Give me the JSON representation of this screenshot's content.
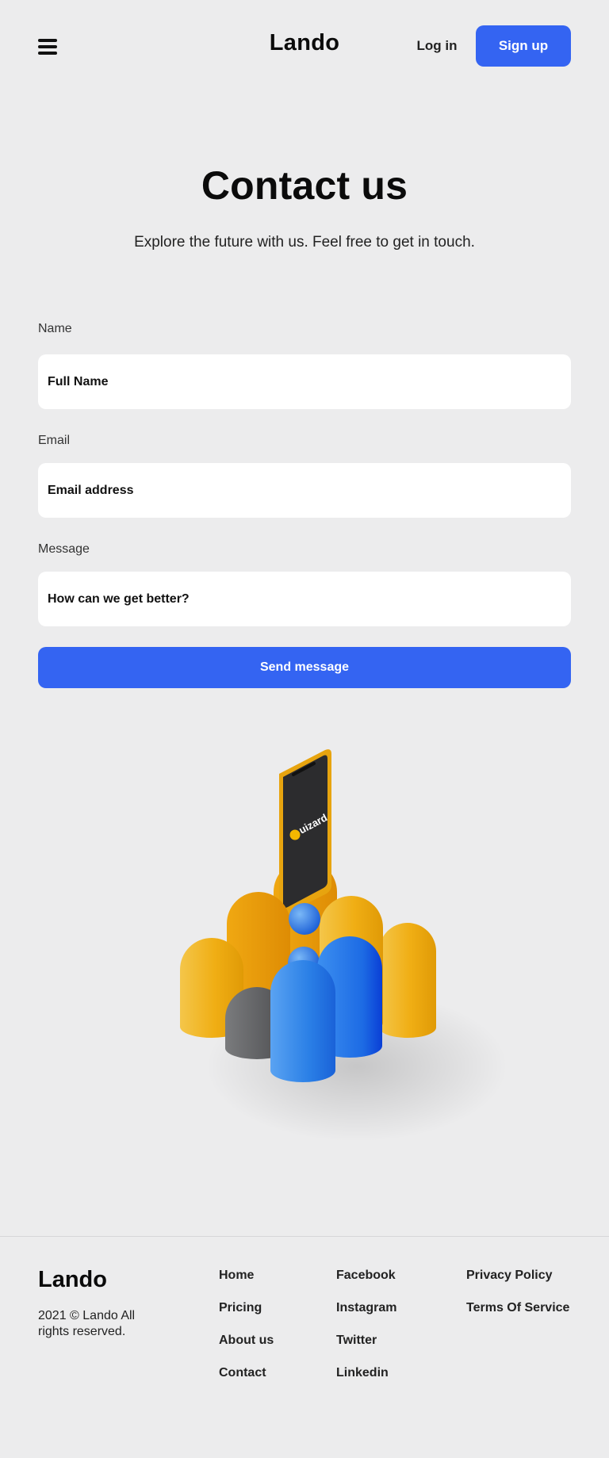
{
  "header": {
    "logo": "Lando",
    "login_label": "Log in",
    "signup_label": "Sign up"
  },
  "hero": {
    "title": "Contact us",
    "subtitle": "Explore the future with us. Feel free to get in touch."
  },
  "form": {
    "name_label": "Name",
    "name_placeholder": "Full Name",
    "email_label": "Email",
    "email_placeholder": "Email address",
    "message_label": "Message",
    "message_placeholder": "How can we get better?",
    "submit_label": "Send message"
  },
  "illustration": {
    "phone_brand": "uizard"
  },
  "footer": {
    "logo": "Lando",
    "copyright": "2021 © Lando All rights reserved.",
    "nav_links": [
      "Home",
      "Pricing",
      "About us",
      "Contact"
    ],
    "social_links": [
      "Facebook",
      "Instagram",
      "Twitter",
      "Linkedin"
    ],
    "legal_links": [
      "Privacy Policy",
      "Terms Of Service"
    ]
  },
  "colors": {
    "accent": "#3464f2",
    "background": "#ececed",
    "field_bg": "#ffffff"
  }
}
